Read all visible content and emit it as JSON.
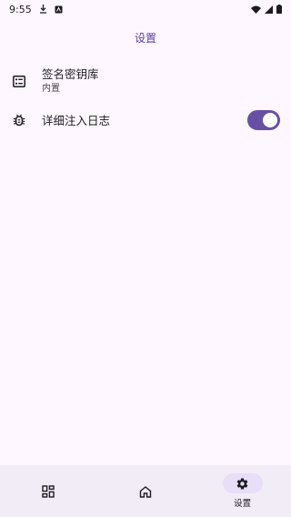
{
  "status_bar": {
    "time": "9:55",
    "icons": [
      "download-icon",
      "app-notification-icon",
      "wifi-icon",
      "cellular-icon",
      "battery-icon"
    ]
  },
  "header": {
    "title": "设置"
  },
  "settings": {
    "keystore": {
      "icon": "keystore-icon",
      "title": "签名密钥库",
      "subtitle": "内置"
    },
    "verbose_logging": {
      "icon": "bug-icon",
      "title": "详细注入日志",
      "enabled": true
    }
  },
  "bottom_nav": {
    "items": [
      {
        "icon": "apps-icon",
        "label": ""
      },
      {
        "icon": "home-icon",
        "label": ""
      },
      {
        "icon": "gear-icon",
        "label": "设置",
        "active": true
      }
    ]
  },
  "colors": {
    "accent": "#6750a4",
    "background": "#fef7ff",
    "nav_background": "#f2ecf6",
    "active_indicator": "#e8def8"
  }
}
